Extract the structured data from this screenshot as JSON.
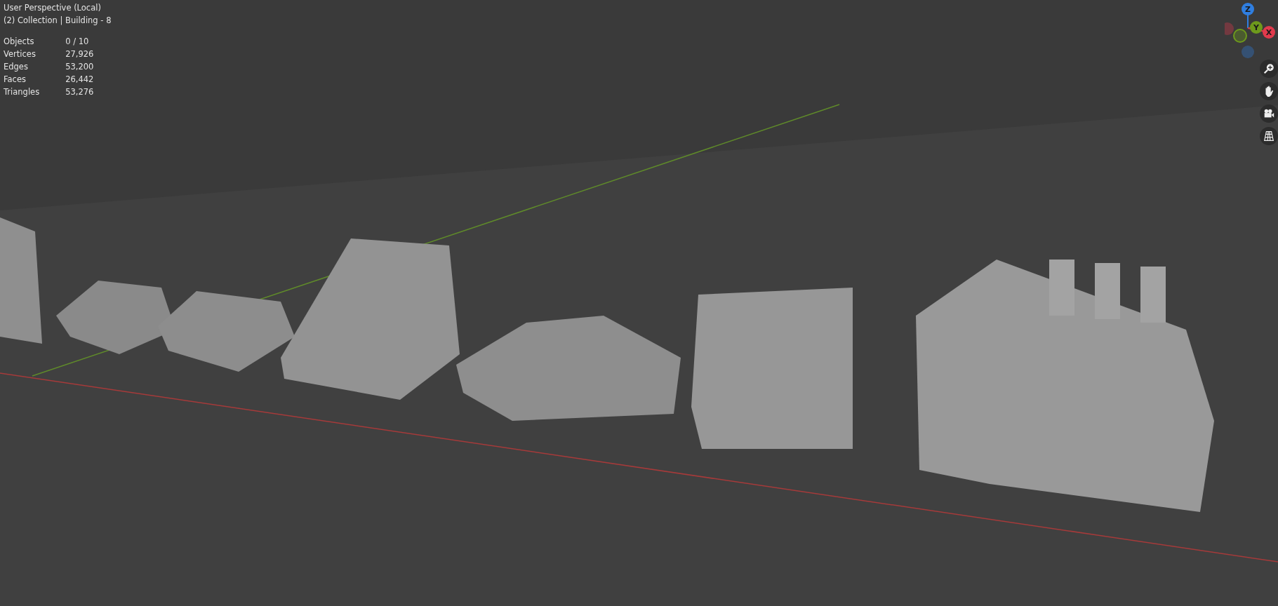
{
  "viewport": {
    "mode": "User Perspective (Local)",
    "context": "(2) Collection | Building - 8",
    "stats": [
      {
        "label": "Objects",
        "value": "0 / 10"
      },
      {
        "label": "Vertices",
        "value": "27,926"
      },
      {
        "label": "Edges",
        "value": "53,200"
      },
      {
        "label": "Faces",
        "value": "26,442"
      },
      {
        "label": "Triangles",
        "value": "53,276"
      }
    ],
    "gizmo_axes": [
      {
        "label": "Z",
        "color": "#2f7ee0"
      },
      {
        "label": "Y",
        "color": "#6e9a1c"
      },
      {
        "label": "X",
        "color": "#e03a4c"
      }
    ]
  }
}
